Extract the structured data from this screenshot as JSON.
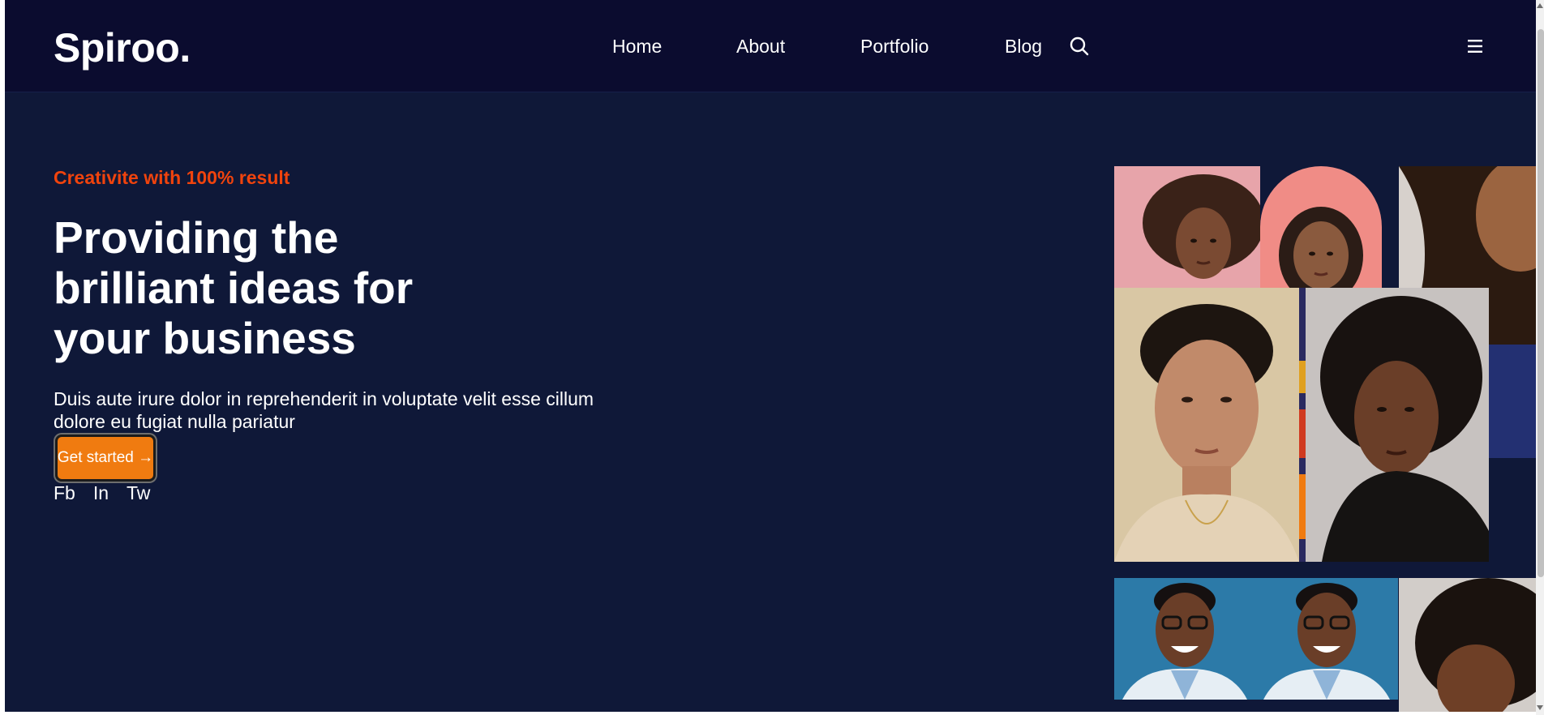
{
  "header": {
    "logo": "Spiroo.",
    "nav": [
      {
        "label": "Home"
      },
      {
        "label": "About"
      },
      {
        "label": "Portfolio"
      },
      {
        "label": "Blog"
      }
    ],
    "search_icon": "search-icon",
    "menu_icon": "hamburger-menu-icon"
  },
  "hero": {
    "tagline": "Creativite with 100% result",
    "headline": "Providing the brilliant ideas for your business",
    "description": "Duis aute irure dolor in reprehenderit in voluptate velit esse cillum dolore eu fugiat nulla pariatur",
    "cta_label": "Get started →",
    "socials": [
      "Fb",
      "In",
      "Tw"
    ]
  },
  "colors": {
    "navbar_bg": "#0b0c2f",
    "page_bg": "#0f1838",
    "accent_red": "#f0430d",
    "button_orange": "#f07b10",
    "text": "#ffffff"
  }
}
